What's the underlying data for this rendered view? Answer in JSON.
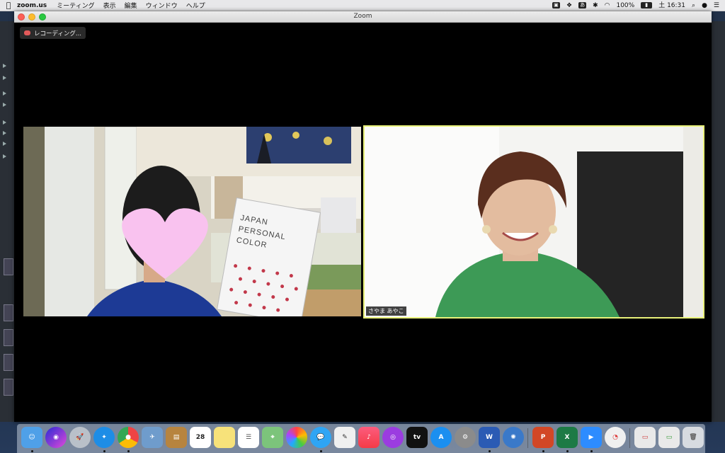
{
  "menubar": {
    "apple": "",
    "app_name": "zoom.us",
    "menus": [
      "ミーティング",
      "表示",
      "編集",
      "ウィンドウ",
      "ヘルプ"
    ],
    "status": {
      "battery": "100%",
      "datetime": "土 16:31"
    }
  },
  "window": {
    "title": "Zoom"
  },
  "recording": {
    "label": "レコーディング..."
  },
  "participants": [
    {
      "name": "",
      "book_text": "JAPAN PERSONAL COLOR",
      "active": false
    },
    {
      "name": "さやま あやこ",
      "active": true
    }
  ],
  "dock": {
    "calendar_date": "28",
    "apps": [
      "finder",
      "siri",
      "launchpad",
      "safari",
      "chrome",
      "preview",
      "notebooks",
      "calendar",
      "notes",
      "reminders",
      "maps",
      "photos",
      "messages",
      "textedit",
      "music",
      "podcasts",
      "tv",
      "app-store",
      "system-preferences",
      "word",
      "network",
      "powerpoint",
      "excel",
      "zoom",
      "activity-monitor",
      "window-1",
      "window-2",
      "trash"
    ]
  },
  "colors": {
    "active_speaker_border": "#e9f27a",
    "zoom_bg": "#000000"
  }
}
